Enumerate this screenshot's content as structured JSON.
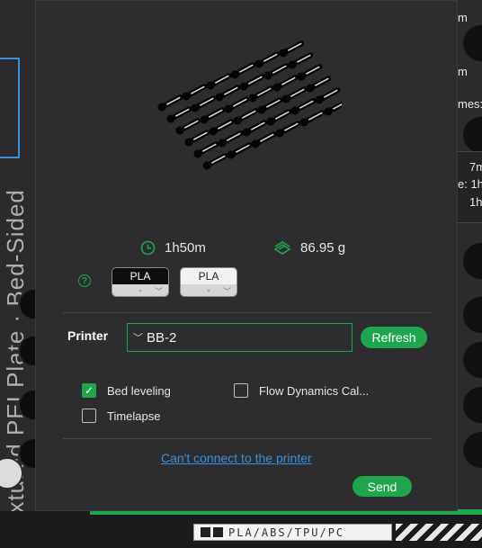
{
  "background": {
    "left_vertical_text": "Textured PEI Plate  ·  Bed-Sided",
    "right_labels": [
      "m",
      "m",
      "mes:",
      "7m",
      "e: 1h",
      "1h"
    ],
    "material_label": "PLA/ABS/TPU/PC"
  },
  "dialog": {
    "stats": {
      "print_time": "1h50m",
      "filament_weight": "86.95 g"
    },
    "filaments": [
      {
        "name": "PLA",
        "slot": "-",
        "color": "#0e0e0e"
      },
      {
        "name": "PLA",
        "slot": "-",
        "color": "#f2f2f2"
      }
    ],
    "printer": {
      "label": "Printer",
      "selected": "BB-2",
      "refresh_label": "Refresh"
    },
    "options": {
      "bed_leveling": {
        "label": "Bed leveling",
        "checked": true
      },
      "flow_calibration": {
        "label": "Flow Dynamics Cal...",
        "checked": false
      },
      "timelapse": {
        "label": "Timelapse",
        "checked": false
      }
    },
    "cant_connect_link": "Can't connect to the printer",
    "send_label": "Send"
  },
  "colors": {
    "accent": "#1fa64c",
    "link": "#3b8fd9",
    "dialog_bg": "#2d2d30"
  },
  "icons": {
    "time": "clock-icon",
    "weight": "filament-weight-icon",
    "help": "help-icon",
    "dropdown": "chevron-down-icon",
    "checkbox": "checkmark-icon"
  }
}
